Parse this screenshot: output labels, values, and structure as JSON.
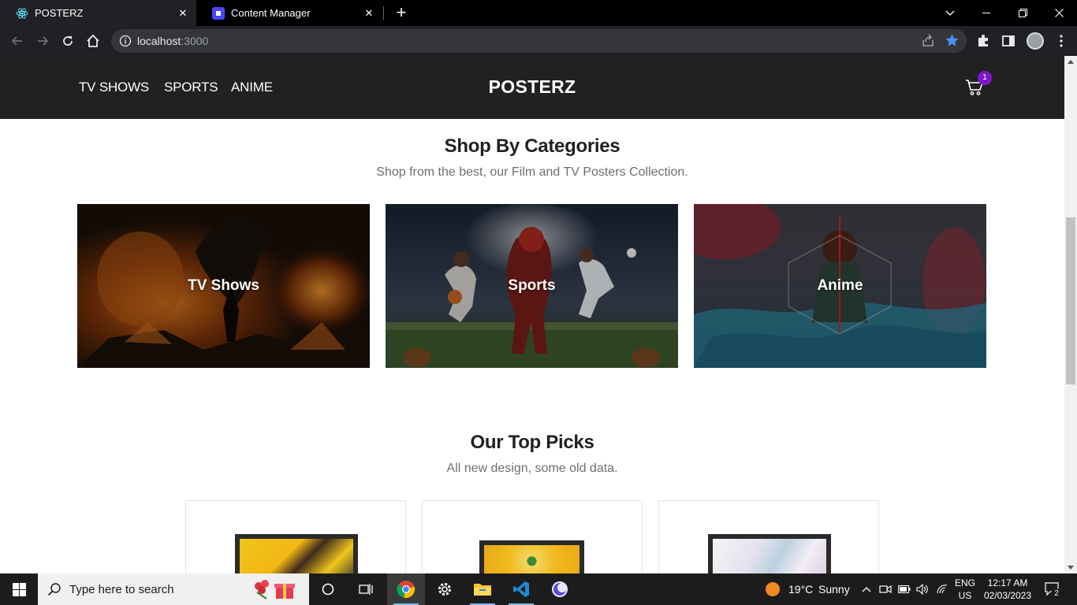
{
  "browser": {
    "tabs": [
      {
        "title": "POSTERZ",
        "active": true,
        "icon": "react-icon"
      },
      {
        "title": "Content Manager",
        "active": false,
        "icon": "strapi-icon"
      }
    ],
    "url_host": "localhost",
    "url_port": ":3000"
  },
  "site": {
    "nav_links": [
      "TV SHOWS",
      "SPORTS",
      "ANIME"
    ],
    "brand": "POSTERZ",
    "cart_count": "1"
  },
  "categories_section": {
    "title": "Shop By Categories",
    "subtitle": "Shop from the best, our Film and TV Posters Collection.",
    "items": [
      {
        "label": "TV Shows"
      },
      {
        "label": "Sports"
      },
      {
        "label": "Anime"
      }
    ]
  },
  "top_picks_section": {
    "title": "Our Top Picks",
    "subtitle": "All new design, some old data."
  },
  "taskbar": {
    "search_placeholder": "Type here to search",
    "weather_temp": "19°C",
    "weather_desc": "Sunny",
    "lang_top": "ENG",
    "lang_bottom": "US",
    "time": "12:17 AM",
    "date": "02/03/2023",
    "notifications": "2"
  },
  "colors": {
    "site_nav_bg": "#212121",
    "cart_badge": "#7e18c9",
    "browser_star": "#8ab4f8"
  }
}
